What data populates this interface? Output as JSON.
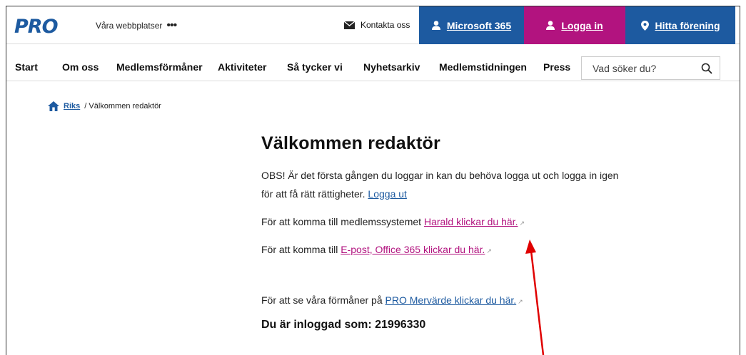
{
  "header": {
    "logo": "PRO",
    "sites_label": "Våra webbplatser",
    "contact_label": "Kontakta oss",
    "ms365_label": "Microsoft 365",
    "login_label": "Logga in",
    "find_label": "Hitta förening"
  },
  "nav": {
    "items": [
      "Start",
      "Om oss",
      "Medlemsförmåner",
      "Aktiviteter",
      "Så tycker vi",
      "Nyhetsarkiv",
      "Medlemstidningen",
      "Press"
    ],
    "search_placeholder": "Vad söker du?"
  },
  "breadcrumb": {
    "home": "Riks",
    "current": "/ Välkommen redaktör"
  },
  "main": {
    "title": "Välkommen redaktör",
    "p1_text": "OBS! Är det första gången du loggar in kan du behöva logga ut och logga in igen för att få rätt rättigheter.",
    "p1_link": "Logga ut",
    "p2_text": "För att komma till medlemssystemet",
    "p2_link": "Harald klickar du här.",
    "p3_text": "För att komma till",
    "p3_link": "E-post, Office 365 klickar du här.",
    "p4_text": "För att se våra förmåner på",
    "p4_link": "PRO Mervärde klickar du här.",
    "logged_in": "Du är inloggad som: 21996330"
  },
  "colors": {
    "brand_blue": "#1d5aa0",
    "brand_pink": "#b2137f",
    "annotation_red": "#e00000"
  }
}
